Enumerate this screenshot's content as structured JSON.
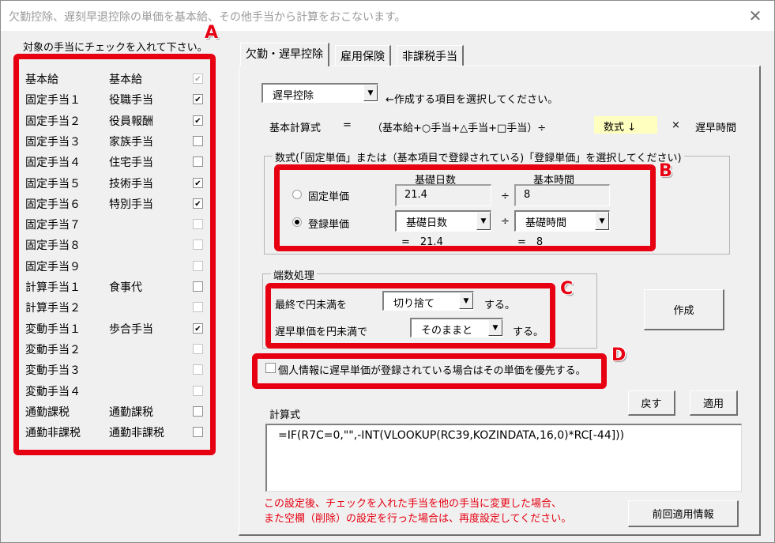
{
  "window": {
    "title": "欠勤控除、遅刻早退控除の単価を基本給、その他手当から計算をおこないます。",
    "close_icon": "✕"
  },
  "left_panel": {
    "instruction": "対象の手当にチェックを入れて下さい。",
    "items": [
      {
        "category": "基本給",
        "name": "基本給",
        "checked": true,
        "disabled": true
      },
      {
        "category": "固定手当１",
        "name": "役職手当",
        "checked": true,
        "disabled": false
      },
      {
        "category": "固定手当２",
        "name": "役員報酬",
        "checked": true,
        "disabled": false
      },
      {
        "category": "固定手当３",
        "name": "家族手当",
        "checked": false,
        "disabled": false
      },
      {
        "category": "固定手当４",
        "name": "住宅手当",
        "checked": false,
        "disabled": false
      },
      {
        "category": "固定手当５",
        "name": "技術手当",
        "checked": true,
        "disabled": false
      },
      {
        "category": "固定手当６",
        "name": "特別手当",
        "checked": true,
        "disabled": false
      },
      {
        "category": "固定手当７",
        "name": "",
        "checked": false,
        "disabled": true
      },
      {
        "category": "固定手当８",
        "name": "",
        "checked": false,
        "disabled": true
      },
      {
        "category": "固定手当９",
        "name": "",
        "checked": false,
        "disabled": true
      },
      {
        "category": "計算手当１",
        "name": "食事代",
        "checked": false,
        "disabled": false
      },
      {
        "category": "計算手当２",
        "name": "",
        "checked": false,
        "disabled": true
      },
      {
        "category": "変動手当１",
        "name": "歩合手当",
        "checked": true,
        "disabled": false
      },
      {
        "category": "変動手当２",
        "name": "",
        "checked": false,
        "disabled": true
      },
      {
        "category": "変動手当３",
        "name": "",
        "checked": false,
        "disabled": true
      },
      {
        "category": "変動手当４",
        "name": "",
        "checked": false,
        "disabled": true
      },
      {
        "category": "通勤課税",
        "name": "通勤課税",
        "checked": false,
        "disabled": false
      },
      {
        "category": "通勤非課税",
        "name": "通勤非課税",
        "checked": false,
        "disabled": false
      }
    ]
  },
  "tabs": [
    {
      "label": "欠勤・遅早控除",
      "active": true
    },
    {
      "label": "雇用保険",
      "active": false
    },
    {
      "label": "非課税手当",
      "active": false
    }
  ],
  "main": {
    "item_select": {
      "value": "遅早控除",
      "hint": "←作成する項目を選択してください。"
    },
    "base_formula": {
      "label": "基本計算式",
      "eq": "=",
      "expr": "（基本給+○手当+△手当+□手当）÷",
      "highlight": "数式 ↓",
      "times": "×",
      "tail": "遅早時間"
    },
    "formula_group": {
      "legend": "数式(「固定単価」または（基本項目で登録されている)「登録単価」を選択してください)",
      "header_days": "基礎日数",
      "header_hours": "基本時間",
      "fixed": {
        "label": "固定単価",
        "selected": false,
        "days": "21.4",
        "div": "÷",
        "hours": "8"
      },
      "registered": {
        "label": "登録単価",
        "selected": true,
        "days_select": "基礎日数",
        "div": "÷",
        "hours_select": "基礎時間",
        "days_result": "=　21.4",
        "hours_result": "=　8"
      }
    },
    "rounding": {
      "legend": "端数処理",
      "final_label": "最終で円未満を",
      "final_value": "切り捨て",
      "final_suffix": "する。",
      "unit_label": "遅早単価を円未満で",
      "unit_value": "そのままと",
      "unit_suffix": "する。"
    },
    "create_button": "作成",
    "priority_checkbox": {
      "label": "個人情報に遅早単価が登録されている場合はその単価を優先する。",
      "checked": false
    },
    "revert_button": "戻す",
    "apply_button": "適用",
    "formula_label": "計算式",
    "formula_value": "=IF(R7C=0,\"\",-INT(VLOOKUP(RC39,KOZINDATA,16,0)*RC[-44]))",
    "warning_line1": "この設定後、チェックを入れた手当を他の手当に変更した場合、",
    "warning_line2": "また空欄（削除）の設定を行った場合は、再度設定してください。",
    "previous_info_button": "前回適用情報"
  },
  "annotations": {
    "a": "A",
    "b": "B",
    "c": "C",
    "d": "D",
    "color": "#e60012"
  }
}
